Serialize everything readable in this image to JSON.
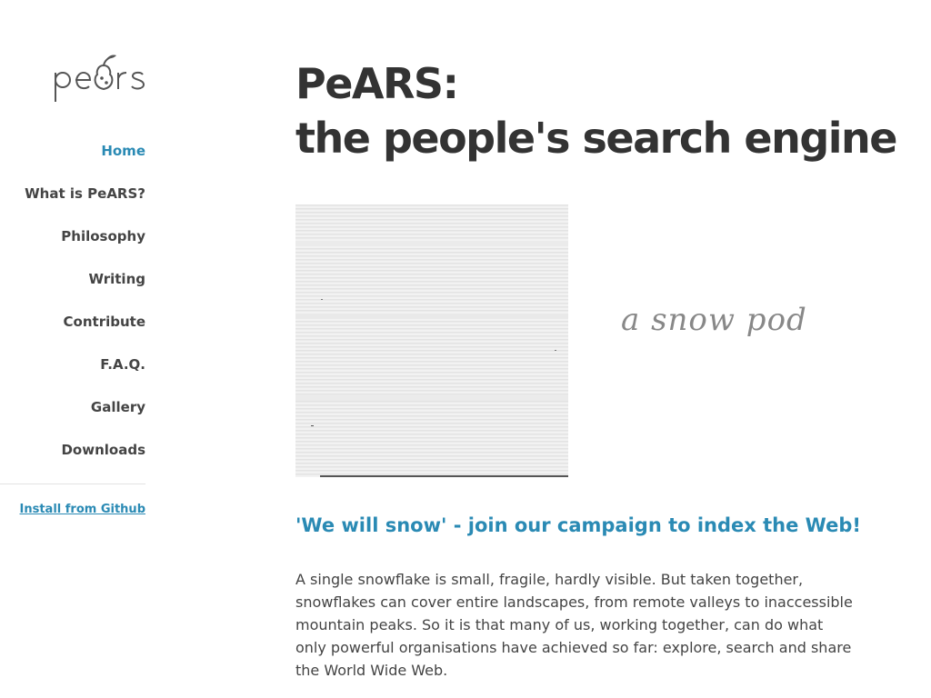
{
  "logo": {
    "text": "pears",
    "icon": "pear-logo-icon"
  },
  "nav": {
    "items": [
      {
        "label": "Home",
        "active": true
      },
      {
        "label": "What is PeARS?",
        "active": false
      },
      {
        "label": "Philosophy",
        "active": false
      },
      {
        "label": "Writing",
        "active": false
      },
      {
        "label": "Contribute",
        "active": false
      },
      {
        "label": "F.A.Q.",
        "active": false
      },
      {
        "label": "Gallery",
        "active": false
      },
      {
        "label": "Downloads",
        "active": false
      }
    ],
    "install_label": "Install from Github"
  },
  "main": {
    "title_line1": "PeARS:",
    "title_line2": "the people's search engine",
    "hero_caption": "a snow pod",
    "campaign_heading": "'We will snow' - join our campaign to index the Web!",
    "intro": "A single snowflake is small, fragile, hardly visible. But taken together, snowflakes can cover entire landscapes, from remote valleys to inaccessible mountain peaks. So it is that many of us, working together, can do what only powerful organisations have achieved so far: explore, search and share the World Wide Web."
  },
  "colors": {
    "accent": "#2a8ab4",
    "text": "#333333",
    "nav_text": "#444444",
    "caption": "#888888"
  }
}
